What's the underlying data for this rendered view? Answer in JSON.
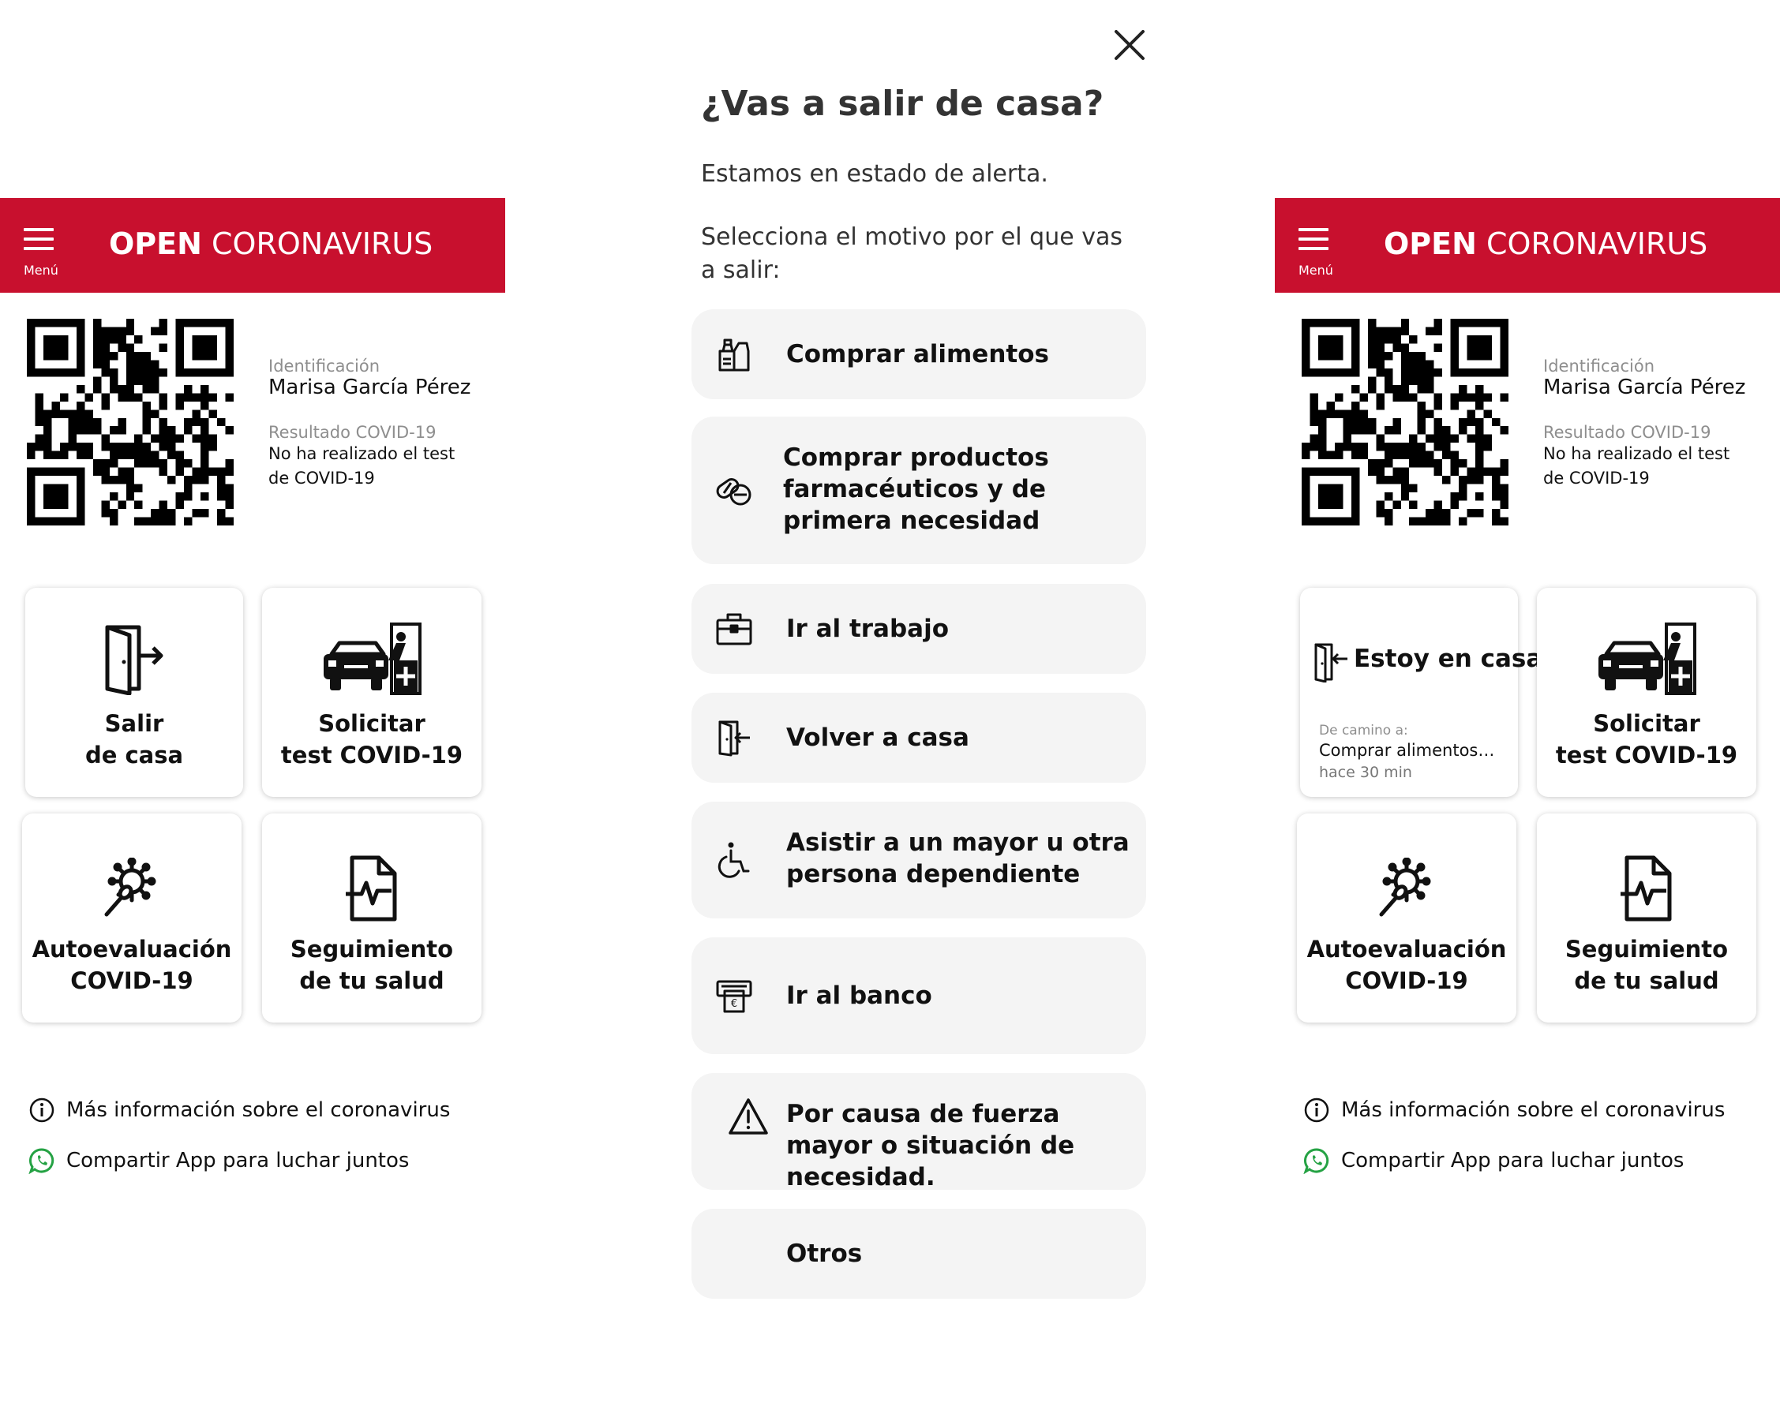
{
  "app": {
    "menu_label": "Menú",
    "brand_bold": "OPEN",
    "brand_regular": "CORONAVIRUS"
  },
  "profile": {
    "id_label": "Identificación",
    "name": "Marisa García Pérez",
    "result_label": "Resultado COVID-19",
    "result_line1": "No ha realizado el test",
    "result_line2": "de COVID-19"
  },
  "cards": {
    "leave_line1": "Salir",
    "leave_line2": "de casa",
    "test_line1": "Solicitar",
    "test_line2": "test COVID-19",
    "selfeval_line1": "Autoevaluación",
    "selfeval_line2": "COVID-19",
    "health_line1": "Seguimiento",
    "health_line2": "de tu salud",
    "home_label": "Estoy en casa",
    "onway_label": "De camino a:",
    "onway_value": "Comprar alimentos…",
    "onway_time": "hace 30 min"
  },
  "links": {
    "info": "Más información sobre el coronavirus",
    "share": "Compartir App para luchar juntos"
  },
  "modal": {
    "title": "¿Vas a salir de casa?",
    "subtitle": "Estamos en estado de alerta.",
    "instruction": "Selecciona el motivo por el que vas a salir:",
    "options": [
      {
        "label": "Comprar alimentos",
        "icon": "grocery-icon"
      },
      {
        "label": "Comprar productos farmacéuticos y de primera necesidad",
        "icon": "pills-icon"
      },
      {
        "label": "Ir al trabajo",
        "icon": "briefcase-icon"
      },
      {
        "label": "Volver a casa",
        "icon": "door-enter-icon"
      },
      {
        "label": "Asistir a un mayor u otra persona dependiente",
        "icon": "wheelchair-icon"
      },
      {
        "label": "Ir al banco",
        "icon": "atm-icon"
      },
      {
        "label": "Por causa de fuerza mayor o situación de necesidad.",
        "icon": "warning-icon"
      },
      {
        "label": "Otros",
        "icon": ""
      }
    ]
  },
  "colors": {
    "brand_red": "#c8102e",
    "option_bg": "#f4f4f4",
    "whatsapp_green": "#25a244"
  }
}
